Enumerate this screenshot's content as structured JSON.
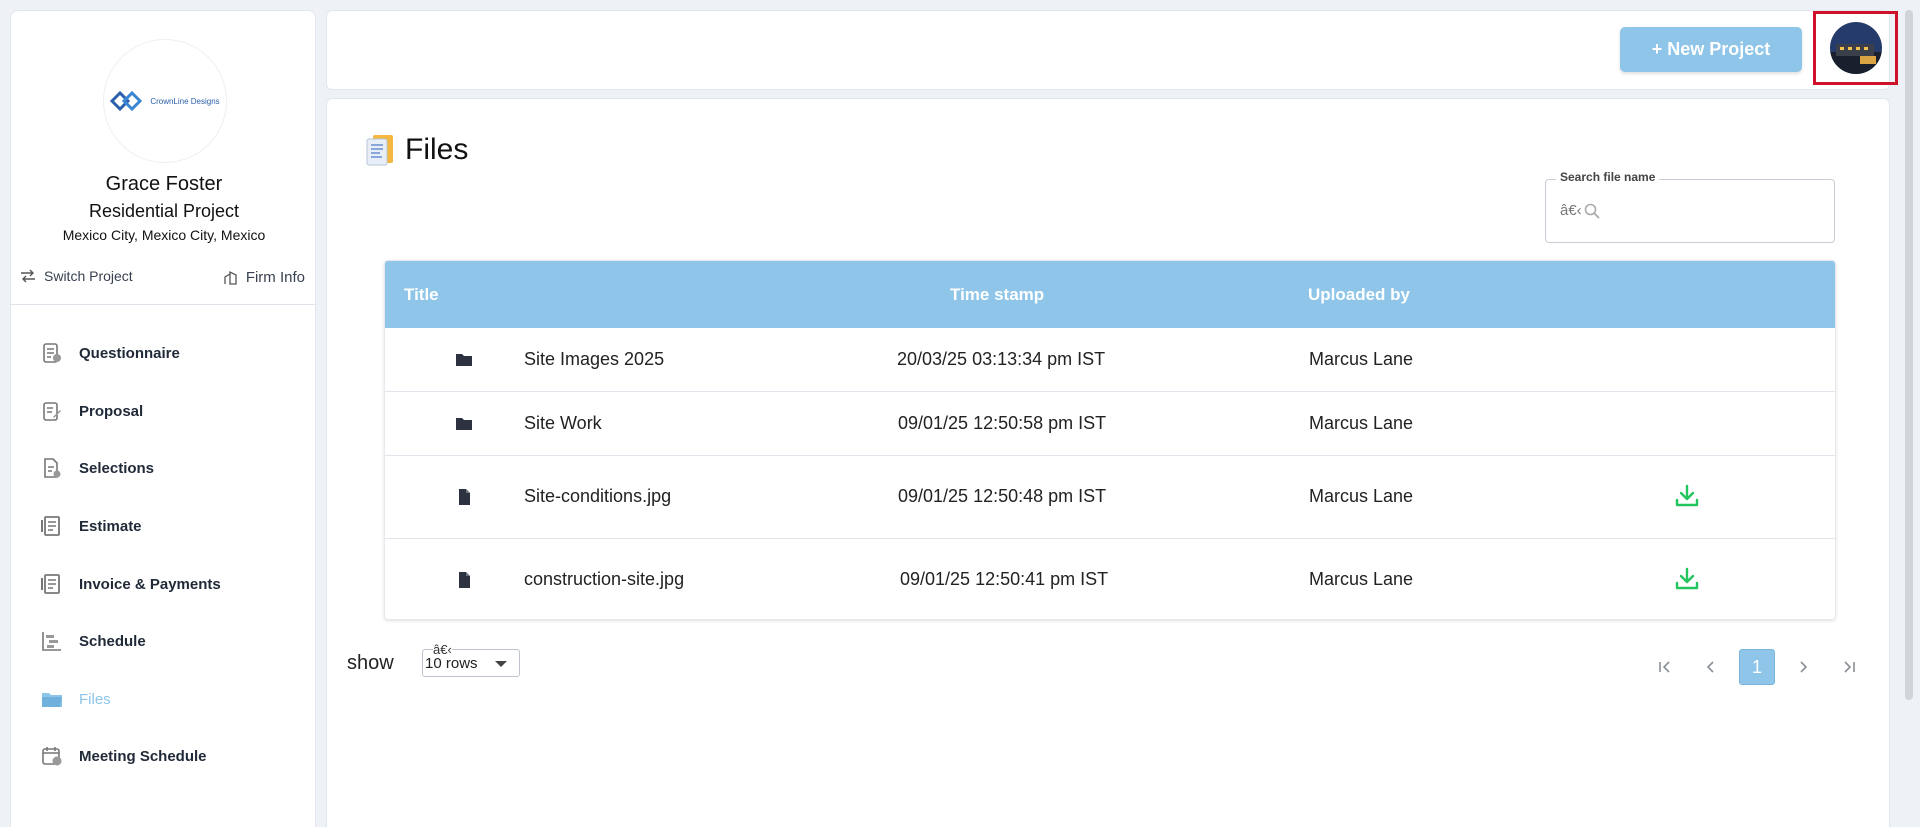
{
  "sidebar": {
    "logo_text": "CrownLine Designs",
    "client_name": "Grace Foster",
    "project_type": "Residential Project",
    "location": "Mexico City, Mexico City, Mexico",
    "switch_project": "Switch Project",
    "firm_info": "Firm Info",
    "items": [
      {
        "label": "Questionnaire",
        "icon": "questionnaire-icon"
      },
      {
        "label": "Proposal",
        "icon": "proposal-icon"
      },
      {
        "label": "Selections",
        "icon": "selections-icon"
      },
      {
        "label": "Estimate",
        "icon": "estimate-icon"
      },
      {
        "label": "Invoice & Payments",
        "icon": "invoice-icon"
      },
      {
        "label": "Schedule",
        "icon": "schedule-icon"
      },
      {
        "label": "Files",
        "icon": "folder-icon",
        "active": true
      },
      {
        "label": "Meeting Schedule",
        "icon": "calendar-icon"
      }
    ]
  },
  "topbar": {
    "new_project": "+ New Project"
  },
  "main": {
    "title": "Files",
    "search": {
      "label": "Search file name",
      "garbled": "â€‹"
    },
    "table": {
      "headers": [
        "Title",
        "Time stamp",
        "Uploaded by"
      ],
      "rows": [
        {
          "type": "folder",
          "title": "Site Images 2025",
          "timestamp": "20/03/25 03:13:34 pm IST",
          "uploaded_by": "Marcus Lane",
          "download": false
        },
        {
          "type": "folder",
          "title": "Site Work",
          "timestamp": "09/01/25 12:50:58 pm IST",
          "uploaded_by": "Marcus Lane",
          "download": false
        },
        {
          "type": "file",
          "title": "Site-conditions.jpg",
          "timestamp": "09/01/25 12:50:48 pm IST",
          "uploaded_by": "Marcus Lane",
          "download": true
        },
        {
          "type": "file",
          "title": "construction-site.jpg",
          "timestamp": "09/01/25 12:50:41 pm IST",
          "uploaded_by": "Marcus Lane",
          "download": true
        }
      ]
    },
    "footer": {
      "show_label": "show",
      "rows_garbled": "â€‹",
      "rows_value": "10 rows",
      "current_page": "1"
    }
  },
  "colors": {
    "accent": "#8ec5e8",
    "download": "#22c55e",
    "avatar_highlight": "#d0112b"
  }
}
